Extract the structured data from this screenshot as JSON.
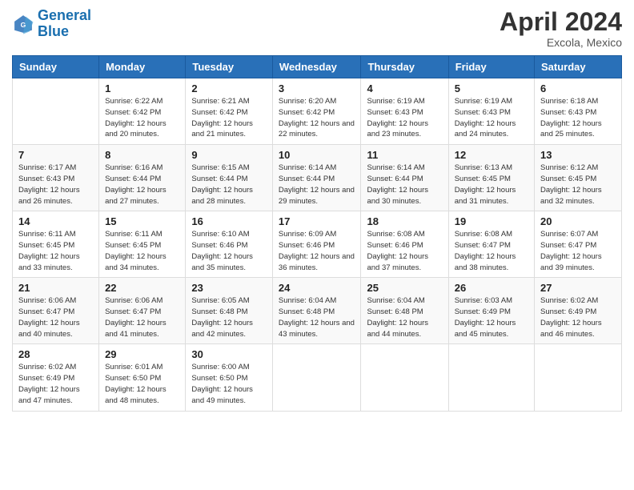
{
  "logo": {
    "line1": "General",
    "line2": "Blue"
  },
  "title": "April 2024",
  "subtitle": "Excola, Mexico",
  "days_header": [
    "Sunday",
    "Monday",
    "Tuesday",
    "Wednesday",
    "Thursday",
    "Friday",
    "Saturday"
  ],
  "weeks": [
    [
      {
        "day": "",
        "sunrise": "",
        "sunset": "",
        "daylight": ""
      },
      {
        "day": "1",
        "sunrise": "Sunrise: 6:22 AM",
        "sunset": "Sunset: 6:42 PM",
        "daylight": "Daylight: 12 hours and 20 minutes."
      },
      {
        "day": "2",
        "sunrise": "Sunrise: 6:21 AM",
        "sunset": "Sunset: 6:42 PM",
        "daylight": "Daylight: 12 hours and 21 minutes."
      },
      {
        "day": "3",
        "sunrise": "Sunrise: 6:20 AM",
        "sunset": "Sunset: 6:42 PM",
        "daylight": "Daylight: 12 hours and 22 minutes."
      },
      {
        "day": "4",
        "sunrise": "Sunrise: 6:19 AM",
        "sunset": "Sunset: 6:43 PM",
        "daylight": "Daylight: 12 hours and 23 minutes."
      },
      {
        "day": "5",
        "sunrise": "Sunrise: 6:19 AM",
        "sunset": "Sunset: 6:43 PM",
        "daylight": "Daylight: 12 hours and 24 minutes."
      },
      {
        "day": "6",
        "sunrise": "Sunrise: 6:18 AM",
        "sunset": "Sunset: 6:43 PM",
        "daylight": "Daylight: 12 hours and 25 minutes."
      }
    ],
    [
      {
        "day": "7",
        "sunrise": "Sunrise: 6:17 AM",
        "sunset": "Sunset: 6:43 PM",
        "daylight": "Daylight: 12 hours and 26 minutes."
      },
      {
        "day": "8",
        "sunrise": "Sunrise: 6:16 AM",
        "sunset": "Sunset: 6:44 PM",
        "daylight": "Daylight: 12 hours and 27 minutes."
      },
      {
        "day": "9",
        "sunrise": "Sunrise: 6:15 AM",
        "sunset": "Sunset: 6:44 PM",
        "daylight": "Daylight: 12 hours and 28 minutes."
      },
      {
        "day": "10",
        "sunrise": "Sunrise: 6:14 AM",
        "sunset": "Sunset: 6:44 PM",
        "daylight": "Daylight: 12 hours and 29 minutes."
      },
      {
        "day": "11",
        "sunrise": "Sunrise: 6:14 AM",
        "sunset": "Sunset: 6:44 PM",
        "daylight": "Daylight: 12 hours and 30 minutes."
      },
      {
        "day": "12",
        "sunrise": "Sunrise: 6:13 AM",
        "sunset": "Sunset: 6:45 PM",
        "daylight": "Daylight: 12 hours and 31 minutes."
      },
      {
        "day": "13",
        "sunrise": "Sunrise: 6:12 AM",
        "sunset": "Sunset: 6:45 PM",
        "daylight": "Daylight: 12 hours and 32 minutes."
      }
    ],
    [
      {
        "day": "14",
        "sunrise": "Sunrise: 6:11 AM",
        "sunset": "Sunset: 6:45 PM",
        "daylight": "Daylight: 12 hours and 33 minutes."
      },
      {
        "day": "15",
        "sunrise": "Sunrise: 6:11 AM",
        "sunset": "Sunset: 6:45 PM",
        "daylight": "Daylight: 12 hours and 34 minutes."
      },
      {
        "day": "16",
        "sunrise": "Sunrise: 6:10 AM",
        "sunset": "Sunset: 6:46 PM",
        "daylight": "Daylight: 12 hours and 35 minutes."
      },
      {
        "day": "17",
        "sunrise": "Sunrise: 6:09 AM",
        "sunset": "Sunset: 6:46 PM",
        "daylight": "Daylight: 12 hours and 36 minutes."
      },
      {
        "day": "18",
        "sunrise": "Sunrise: 6:08 AM",
        "sunset": "Sunset: 6:46 PM",
        "daylight": "Daylight: 12 hours and 37 minutes."
      },
      {
        "day": "19",
        "sunrise": "Sunrise: 6:08 AM",
        "sunset": "Sunset: 6:47 PM",
        "daylight": "Daylight: 12 hours and 38 minutes."
      },
      {
        "day": "20",
        "sunrise": "Sunrise: 6:07 AM",
        "sunset": "Sunset: 6:47 PM",
        "daylight": "Daylight: 12 hours and 39 minutes."
      }
    ],
    [
      {
        "day": "21",
        "sunrise": "Sunrise: 6:06 AM",
        "sunset": "Sunset: 6:47 PM",
        "daylight": "Daylight: 12 hours and 40 minutes."
      },
      {
        "day": "22",
        "sunrise": "Sunrise: 6:06 AM",
        "sunset": "Sunset: 6:47 PM",
        "daylight": "Daylight: 12 hours and 41 minutes."
      },
      {
        "day": "23",
        "sunrise": "Sunrise: 6:05 AM",
        "sunset": "Sunset: 6:48 PM",
        "daylight": "Daylight: 12 hours and 42 minutes."
      },
      {
        "day": "24",
        "sunrise": "Sunrise: 6:04 AM",
        "sunset": "Sunset: 6:48 PM",
        "daylight": "Daylight: 12 hours and 43 minutes."
      },
      {
        "day": "25",
        "sunrise": "Sunrise: 6:04 AM",
        "sunset": "Sunset: 6:48 PM",
        "daylight": "Daylight: 12 hours and 44 minutes."
      },
      {
        "day": "26",
        "sunrise": "Sunrise: 6:03 AM",
        "sunset": "Sunset: 6:49 PM",
        "daylight": "Daylight: 12 hours and 45 minutes."
      },
      {
        "day": "27",
        "sunrise": "Sunrise: 6:02 AM",
        "sunset": "Sunset: 6:49 PM",
        "daylight": "Daylight: 12 hours and 46 minutes."
      }
    ],
    [
      {
        "day": "28",
        "sunrise": "Sunrise: 6:02 AM",
        "sunset": "Sunset: 6:49 PM",
        "daylight": "Daylight: 12 hours and 47 minutes."
      },
      {
        "day": "29",
        "sunrise": "Sunrise: 6:01 AM",
        "sunset": "Sunset: 6:50 PM",
        "daylight": "Daylight: 12 hours and 48 minutes."
      },
      {
        "day": "30",
        "sunrise": "Sunrise: 6:00 AM",
        "sunset": "Sunset: 6:50 PM",
        "daylight": "Daylight: 12 hours and 49 minutes."
      },
      {
        "day": "",
        "sunrise": "",
        "sunset": "",
        "daylight": ""
      },
      {
        "day": "",
        "sunrise": "",
        "sunset": "",
        "daylight": ""
      },
      {
        "day": "",
        "sunrise": "",
        "sunset": "",
        "daylight": ""
      },
      {
        "day": "",
        "sunrise": "",
        "sunset": "",
        "daylight": ""
      }
    ]
  ]
}
